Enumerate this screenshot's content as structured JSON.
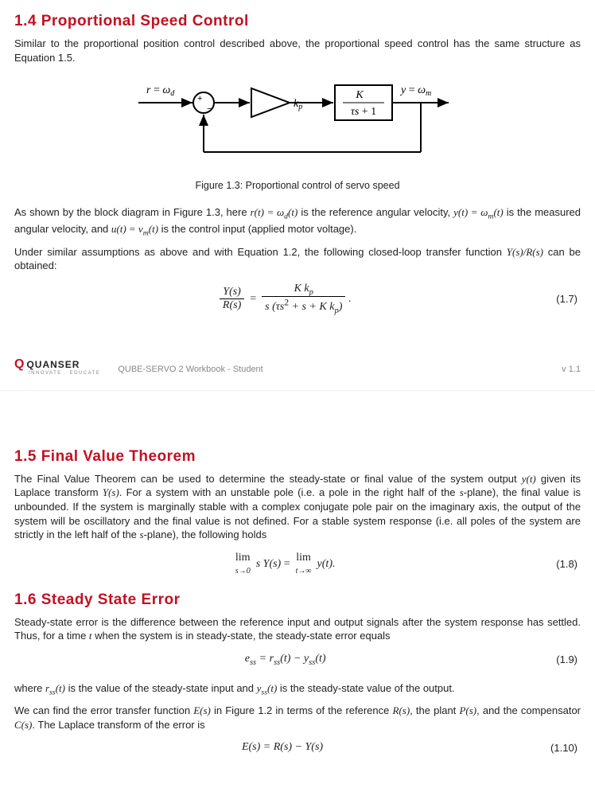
{
  "section14": {
    "heading": "1.4  Proportional Speed Control",
    "intro": "Similar to the proportional position control described above, the proportional speed control has the same structure as Equation 1.5.",
    "fig": {
      "r_label": "r = ω_d",
      "kp_label": "k_p",
      "plant_num": "K",
      "plant_den": "τs + 1",
      "y_label": "y = ω_m",
      "plus": "+",
      "minus": "−",
      "caption": "Figure 1.3: Proportional control of servo speed"
    },
    "para1": "As shown by the block diagram in Figure 1.3, here r(t) = ω_d(t) is the reference angular velocity, y(t) = ω_m(t) is the measured angular velocity, and u(t) = v_m(t) is the control input (applied motor voltage).",
    "para2": "Under similar assumptions as above and with Equation 1.2, the following closed-loop transfer function Y(s)/R(s) can be obtained:",
    "eq17_lhs_num": "Y(s)",
    "eq17_lhs_den": "R(s)",
    "eq17_eq": "=",
    "eq17_rhs_num": "K k_p",
    "eq17_rhs_den": "s (τs² + s + K k_p)",
    "eq17_period": ".",
    "eq17_num": "(1.7)"
  },
  "footer": {
    "brand": "QUANSER",
    "tagline": "INNOVATE · EDUCATE",
    "doc": "QUBE-SERVO 2 Workbook - Student",
    "version": "v 1.1"
  },
  "section15": {
    "heading": "1.5  Final Value Theorem",
    "para": "The Final Value Theorem can be used to determine the steady-state or final value of the system output y(t) given its Laplace transform Y(s). For a system with an unstable pole (i.e. a pole in the right half of the s-plane), the final value is unbounded. If the system is marginally stable with a complex conjugate pole pair on the imaginary axis, the output of the system will be oscillatory and the final value is not defined. For a stable system response (i.e. all poles of the system are strictly in the left half of the s-plane), the following holds",
    "eq18_expr": "lim_{s→0}  s Y(s)  =  lim_{t→∞}  y(t).",
    "eq18_num": "(1.8)"
  },
  "section16": {
    "heading": "1.6  Steady State Error",
    "para1": "Steady-state error is the difference between the reference input and output signals after the system response has settled. Thus, for a time t when the system is in steady-state, the steady-state error equals",
    "eq19_expr": "e_{ss} = r_{ss}(t) − y_{ss}(t)",
    "eq19_num": "(1.9)",
    "para2": "where r_{ss}(t) is the value of the steady-state input and y_{ss}(t) is the steady-state value of the output.",
    "para3": "We can find the error transfer function E(s) in Figure 1.2 in terms of the reference R(s), the plant P(s), and the compensator C(s). The Laplace transform of the error is",
    "eq110_expr": "E(s) = R(s) − Y(s)",
    "eq110_num": "(1.10)"
  }
}
